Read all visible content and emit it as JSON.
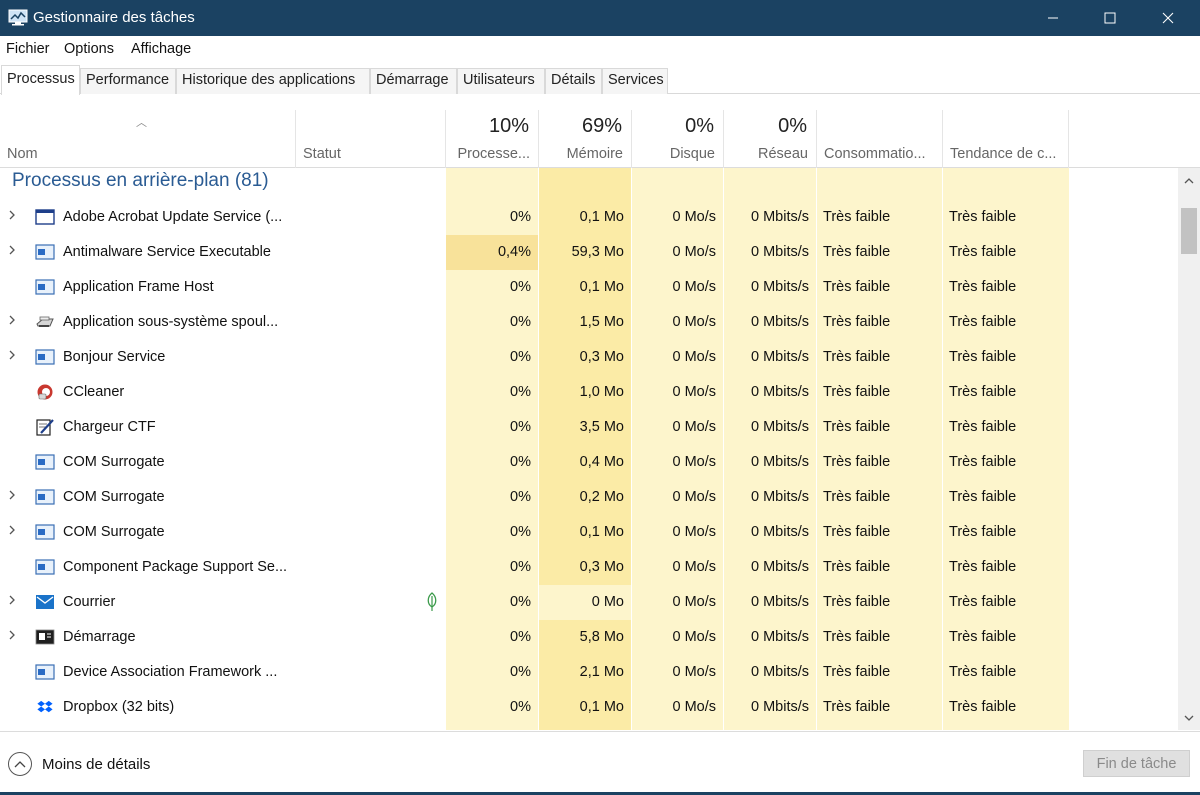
{
  "window": {
    "title": "Gestionnaire des tâches"
  },
  "menu": [
    "Fichier",
    "Options",
    "Affichage"
  ],
  "tabs": [
    "Processus",
    "Performance",
    "Historique des applications",
    "Démarrage",
    "Utilisateurs",
    "Détails",
    "Services"
  ],
  "active_tab": "Processus",
  "columns": {
    "name": "Nom",
    "status": "Statut",
    "cpu": {
      "pct": "10%",
      "label": "Processe..."
    },
    "memory": {
      "pct": "69%",
      "label": "Mémoire"
    },
    "disk": {
      "pct": "0%",
      "label": "Disque"
    },
    "network": {
      "pct": "0%",
      "label": "Réseau"
    },
    "power": {
      "label": "Consommatio..."
    },
    "power_trend": {
      "label": "Tendance de c..."
    }
  },
  "group": {
    "title": "Processus en arrière-plan (81)"
  },
  "processes": [
    {
      "name": "Adobe Acrobat Update Service (...",
      "icon": "service-window-icon",
      "expand": true,
      "cpu": "0%",
      "mem": "0,1 Mo",
      "disk": "0 Mo/s",
      "net": "0 Mbits/s",
      "power": "Très faible",
      "trend": "Très faible"
    },
    {
      "name": "Antimalware Service Executable",
      "icon": "app-window-icon",
      "expand": true,
      "cpu": "0,4%",
      "mem": "59,3 Mo",
      "disk": "0 Mo/s",
      "net": "0 Mbits/s",
      "power": "Très faible",
      "trend": "Très faible"
    },
    {
      "name": "Application Frame Host",
      "icon": "app-window-icon",
      "expand": false,
      "cpu": "0%",
      "mem": "0,1 Mo",
      "disk": "0 Mo/s",
      "net": "0 Mbits/s",
      "power": "Très faible",
      "trend": "Très faible"
    },
    {
      "name": "Application sous-système spoul...",
      "icon": "printer-icon",
      "expand": true,
      "cpu": "0%",
      "mem": "1,5 Mo",
      "disk": "0 Mo/s",
      "net": "0 Mbits/s",
      "power": "Très faible",
      "trend": "Très faible"
    },
    {
      "name": "Bonjour Service",
      "icon": "app-window-icon",
      "expand": true,
      "cpu": "0%",
      "mem": "0,3 Mo",
      "disk": "0 Mo/s",
      "net": "0 Mbits/s",
      "power": "Très faible",
      "trend": "Très faible"
    },
    {
      "name": "CCleaner",
      "icon": "ccleaner-icon",
      "expand": false,
      "cpu": "0%",
      "mem": "1,0 Mo",
      "disk": "0 Mo/s",
      "net": "0 Mbits/s",
      "power": "Très faible",
      "trend": "Très faible"
    },
    {
      "name": "Chargeur CTF",
      "icon": "pen-notepad-icon",
      "expand": false,
      "cpu": "0%",
      "mem": "3,5 Mo",
      "disk": "0 Mo/s",
      "net": "0 Mbits/s",
      "power": "Très faible",
      "trend": "Très faible"
    },
    {
      "name": "COM Surrogate",
      "icon": "app-window-icon",
      "expand": false,
      "cpu": "0%",
      "mem": "0,4 Mo",
      "disk": "0 Mo/s",
      "net": "0 Mbits/s",
      "power": "Très faible",
      "trend": "Très faible"
    },
    {
      "name": "COM Surrogate",
      "icon": "app-window-icon",
      "expand": true,
      "cpu": "0%",
      "mem": "0,2 Mo",
      "disk": "0 Mo/s",
      "net": "0 Mbits/s",
      "power": "Très faible",
      "trend": "Très faible"
    },
    {
      "name": "COM Surrogate",
      "icon": "app-window-icon",
      "expand": true,
      "cpu": "0%",
      "mem": "0,1 Mo",
      "disk": "0 Mo/s",
      "net": "0 Mbits/s",
      "power": "Très faible",
      "trend": "Très faible"
    },
    {
      "name": "Component Package Support Se...",
      "icon": "app-window-icon",
      "expand": false,
      "cpu": "0%",
      "mem": "0,3 Mo",
      "disk": "0 Mo/s",
      "net": "0 Mbits/s",
      "power": "Très faible",
      "trend": "Très faible"
    },
    {
      "name": "Courrier",
      "icon": "mail-icon",
      "expand": true,
      "suspended": true,
      "cpu": "0%",
      "mem": "0 Mo",
      "disk": "0 Mo/s",
      "net": "0 Mbits/s",
      "power": "Très faible",
      "trend": "Très faible"
    },
    {
      "name": "Démarrage",
      "icon": "startup-icon",
      "expand": true,
      "cpu": "0%",
      "mem": "5,8 Mo",
      "disk": "0 Mo/s",
      "net": "0 Mbits/s",
      "power": "Très faible",
      "trend": "Très faible"
    },
    {
      "name": "Device Association Framework ...",
      "icon": "app-window-icon",
      "expand": false,
      "cpu": "0%",
      "mem": "2,1 Mo",
      "disk": "0 Mo/s",
      "net": "0 Mbits/s",
      "power": "Très faible",
      "trend": "Très faible"
    },
    {
      "name": "Dropbox (32 bits)",
      "icon": "dropbox-icon",
      "expand": false,
      "cpu": "0%",
      "mem": "0,1 Mo",
      "disk": "0 Mo/s",
      "net": "0 Mbits/s",
      "power": "Très faible",
      "trend": "Très faible"
    }
  ],
  "footer": {
    "less_details": "Moins de détails",
    "end_task": "Fin de tâche"
  },
  "colors": {
    "titlebar": "#1b4262",
    "group_title": "#2a5b93",
    "heat_light": "#fdf5cc",
    "heat_med": "#fbeba6",
    "heat_strong": "#f8e29a"
  }
}
